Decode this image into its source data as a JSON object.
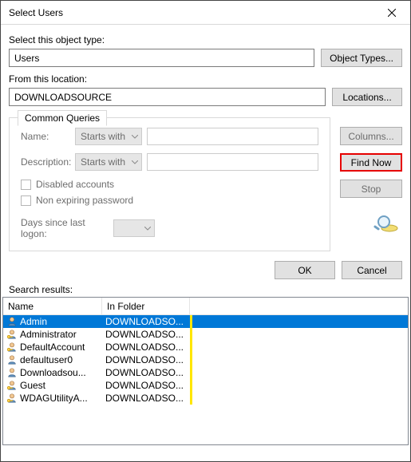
{
  "window": {
    "title": "Select Users"
  },
  "labels": {
    "object_type": "Select this object type:",
    "from_location": "From this location:",
    "search_results": "Search results:"
  },
  "fields": {
    "object_type_value": "Users",
    "location_value": "DOWNLOADSOURCE"
  },
  "buttons": {
    "object_types": "Object Types...",
    "locations": "Locations...",
    "columns": "Columns...",
    "find_now": "Find Now",
    "stop": "Stop",
    "ok": "OK",
    "cancel": "Cancel"
  },
  "queries": {
    "tab": "Common Queries",
    "name_label": "Name:",
    "desc_label": "Description:",
    "starts_with": "Starts with",
    "disabled_accounts": "Disabled accounts",
    "non_expiring": "Non expiring password",
    "days_since": "Days since last logon:"
  },
  "results": {
    "headers": {
      "name": "Name",
      "folder": "In Folder"
    },
    "rows": [
      {
        "name": "Admin",
        "folder": "DOWNLOADSO...",
        "selected": true,
        "icon": "user"
      },
      {
        "name": "Administrator",
        "folder": "DOWNLOADSO...",
        "selected": false,
        "icon": "user-key"
      },
      {
        "name": "DefaultAccount",
        "folder": "DOWNLOADSO...",
        "selected": false,
        "icon": "user-key"
      },
      {
        "name": "defaultuser0",
        "folder": "DOWNLOADSO...",
        "selected": false,
        "icon": "user"
      },
      {
        "name": "Downloadsou...",
        "folder": "DOWNLOADSO...",
        "selected": false,
        "icon": "user"
      },
      {
        "name": "Guest",
        "folder": "DOWNLOADSO...",
        "selected": false,
        "icon": "user-key"
      },
      {
        "name": "WDAGUtilityA...",
        "folder": "DOWNLOADSO...",
        "selected": false,
        "icon": "user-key"
      }
    ]
  }
}
